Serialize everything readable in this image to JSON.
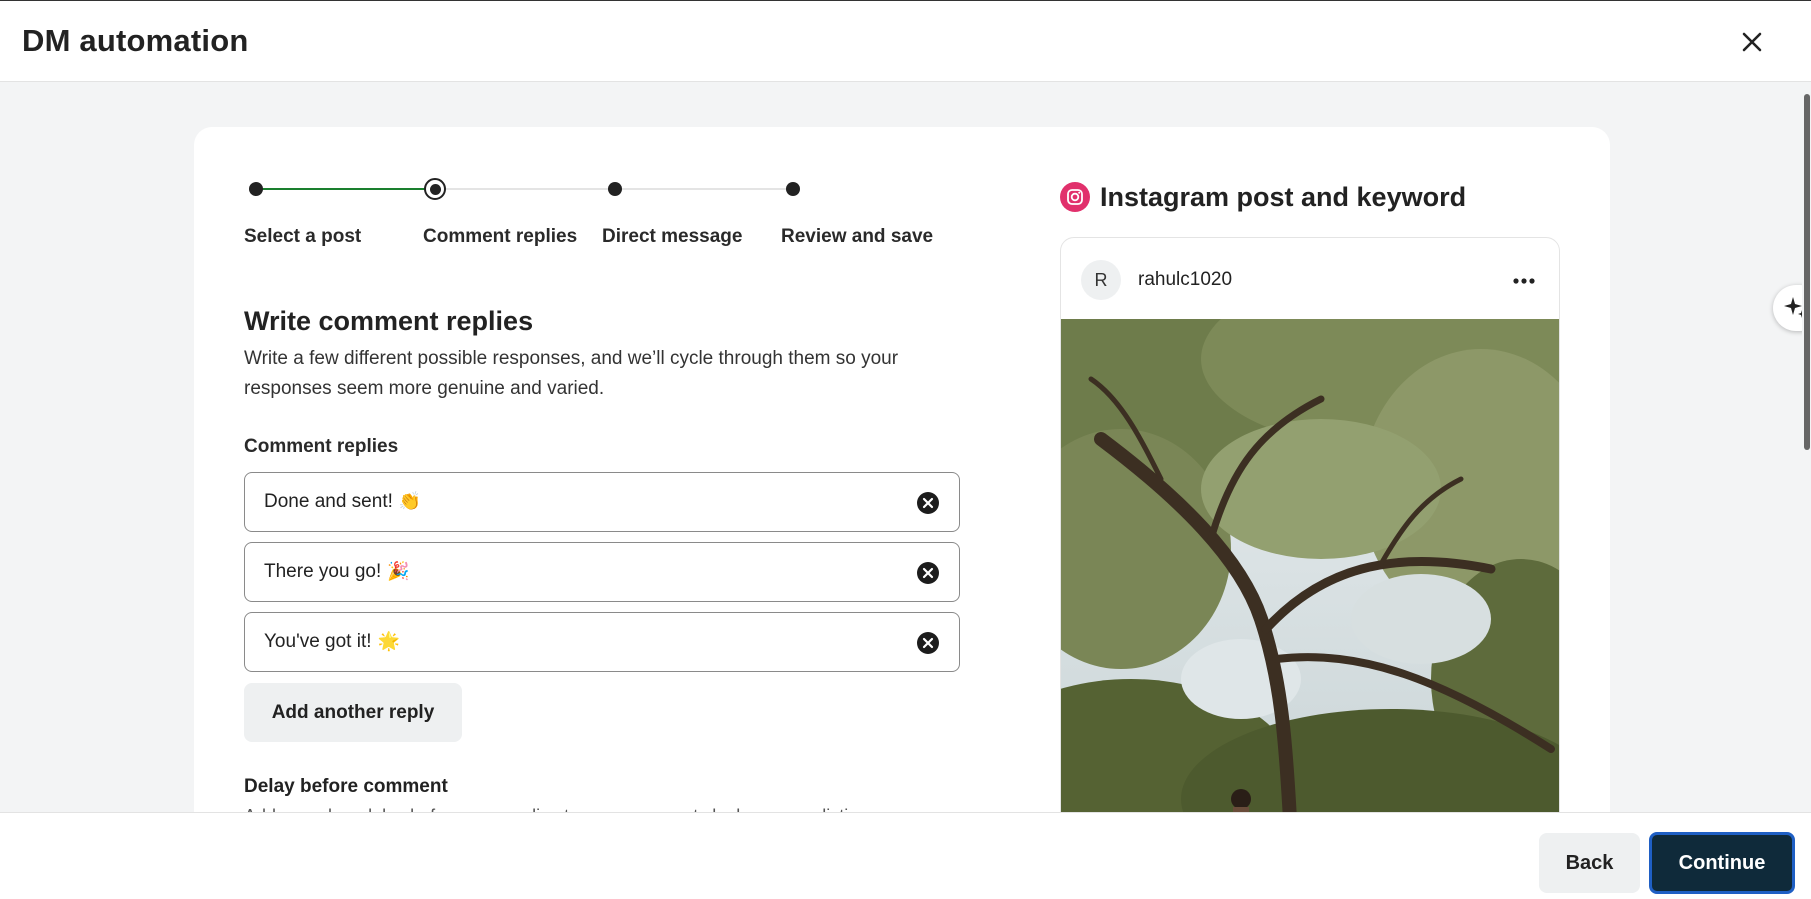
{
  "header": {
    "title": "DM automation"
  },
  "stepper": {
    "steps": [
      {
        "label": "Select a post",
        "state": "done"
      },
      {
        "label": "Comment replies",
        "state": "current"
      },
      {
        "label": "Direct message",
        "state": "upcoming"
      },
      {
        "label": "Review and save",
        "state": "upcoming"
      }
    ]
  },
  "form": {
    "title": "Write comment replies",
    "description": "Write a few different possible responses, and we’ll cycle through them so your responses seem more genuine and varied.",
    "replies_label": "Comment replies",
    "replies": [
      {
        "text": "Done and sent!",
        "emoji": "👏"
      },
      {
        "text": "There you go!",
        "emoji": "🎉"
      },
      {
        "text": "You've got it!",
        "emoji": "🌟"
      }
    ],
    "add_button": "Add another reply",
    "delay_label": "Delay before comment",
    "delay_description": "Add a random delay before your replies to your comments look more realistic."
  },
  "preview": {
    "title": "Instagram post and keyword",
    "username": "rahulc1020",
    "avatar_initial": "R",
    "icon": "instagram-icon"
  },
  "footer": {
    "back_label": "Back",
    "continue_label": "Continue"
  },
  "colors": {
    "progress_done": "#1a7f2e",
    "primary_button": "#0f2a3a",
    "instagram": "#e1306c"
  }
}
